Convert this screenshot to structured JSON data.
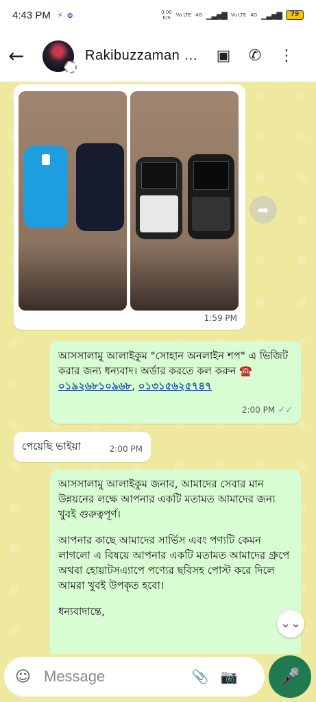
{
  "status_bar": {
    "time": "4:43 PM",
    "net_speed": "0.00",
    "net_unit": "K/S",
    "sim1": "Vo LTE",
    "sim1_tech": "4G",
    "sim2": "Vo LTE",
    "sim2_tech": "4G",
    "battery": "79"
  },
  "header": {
    "contact_name": "Rakibuzzaman Rakib"
  },
  "messages": [
    {
      "type": "image",
      "time": "1:59 PM"
    },
    {
      "type": "text-out",
      "text_prefix": "আসসালামু আলাইকুম \"সোহান অনলাইন শপ\" এ ভিজিট করার জন্য ধন্যবাদ। অর্ডার করতে কল করুন ☎️ ",
      "phone1": "০১৯২৬৮১০৯৬৮",
      "separator": ", ",
      "phone2": "০১৩১৫৬২৫৭৪৭",
      "time": "2:00 PM"
    },
    {
      "type": "text-in",
      "text": "পেয়েছি ভাইয়া",
      "time": "2:00 PM"
    },
    {
      "type": "text-out",
      "para1": "আসসালামু আলাইকুম জনাব, আমাদের সেবার মান উন্নয়নের লক্ষে আপনার একটি মতামত আমাদের জন্য খুবই গুরুত্বপূর্ণ।",
      "para2": "আপনার কাছে আমাদের সার্ভিস এবং পণ্যটি কেমন লাগলো এ বিষয়ে আপনার একটি মতামত আমাদের গ্রুপে অথবা হোয়াটসএ্যাপে পণ্যের ছবিসহ পোস্ট করে দিলে আমরা খুবই উপকৃত হবো।",
      "para3": "ধন্যবাদান্তে,"
    }
  ],
  "composer": {
    "placeholder": "Message"
  },
  "colors": {
    "incoming": "#ffffff",
    "outgoing": "#d9fdd3",
    "wallpaper": "#efe9a0",
    "mic": "#1f7a52"
  }
}
